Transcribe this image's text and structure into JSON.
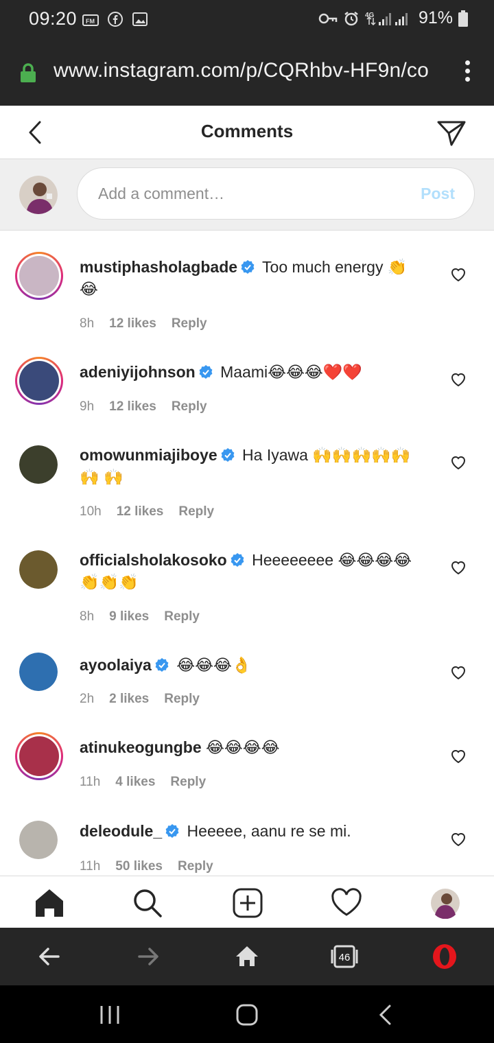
{
  "status_bar": {
    "time": "09:20",
    "battery": "91%",
    "network": "4G"
  },
  "browser": {
    "url": "www.instagram.com/p/CQRhbv-HF9n/co"
  },
  "header": {
    "title": "Comments"
  },
  "composer": {
    "placeholder": "Add a comment…",
    "post_label": "Post"
  },
  "comments": [
    {
      "user": "mustiphasholagbade",
      "verified": true,
      "text": "Too much energy 👏 😂",
      "time": "8h",
      "likes": "12 likes",
      "reply": "Reply",
      "story_ring": true,
      "avatar_color": "#c9b6c4"
    },
    {
      "user": "adeniyijohnson",
      "verified": true,
      "text": "Maami😂😂😂❤️❤️",
      "time": "9h",
      "likes": "12 likes",
      "reply": "Reply",
      "story_ring": true,
      "avatar_color": "#3a4a7a"
    },
    {
      "user": "omowunmiajiboye",
      "verified": true,
      "text": "Ha Iyawa 🙌🙌🙌🙌🙌🙌 🙌",
      "time": "10h",
      "likes": "12 likes",
      "reply": "Reply",
      "story_ring": false,
      "avatar_color": "#3c3f2c"
    },
    {
      "user": "officialsholakosoko",
      "verified": true,
      "text": "Heeeeeeee 😂😂😂😂 👏👏👏",
      "time": "8h",
      "likes": "9 likes",
      "reply": "Reply",
      "story_ring": false,
      "avatar_color": "#6b5a2e"
    },
    {
      "user": "ayoolaiya",
      "verified": true,
      "text": "😂😂😂👌",
      "time": "2h",
      "likes": "2 likes",
      "reply": "Reply",
      "story_ring": false,
      "avatar_color": "#2e6fb0"
    },
    {
      "user": "atinukeogungbe",
      "verified": false,
      "text": "😂😂😂😂",
      "time": "11h",
      "likes": "4 likes",
      "reply": "Reply",
      "story_ring": true,
      "avatar_color": "#a8304a"
    },
    {
      "user": "deleodule_",
      "verified": true,
      "text": "Heeeee, aanu re se mi.",
      "time": "11h",
      "likes": "50 likes",
      "reply": "Reply",
      "story_ring": false,
      "avatar_color": "#b8b4ad"
    }
  ],
  "bottom_nav": {
    "tabs_count": "46"
  },
  "colors": {
    "verified": "#3897f0",
    "post_disabled": "#b2dffc",
    "lock": "#4caf50",
    "opera": "#e4161c"
  },
  "icons": [
    "fm-radio-icon",
    "facebook-icon",
    "gallery-icon",
    "key-icon",
    "alarm-icon",
    "signal-icon",
    "battery-icon",
    "lock-icon",
    "overflow-menu-icon",
    "back-arrow-icon",
    "send-icon",
    "verified-badge-icon",
    "heart-icon",
    "home-icon",
    "search-icon",
    "new-post-icon",
    "activity-heart-icon",
    "profile-avatar-icon",
    "browser-back-icon",
    "browser-forward-icon",
    "browser-home-icon",
    "tabs-icon",
    "opera-icon",
    "recents-icon",
    "home-button-icon",
    "system-back-icon"
  ]
}
